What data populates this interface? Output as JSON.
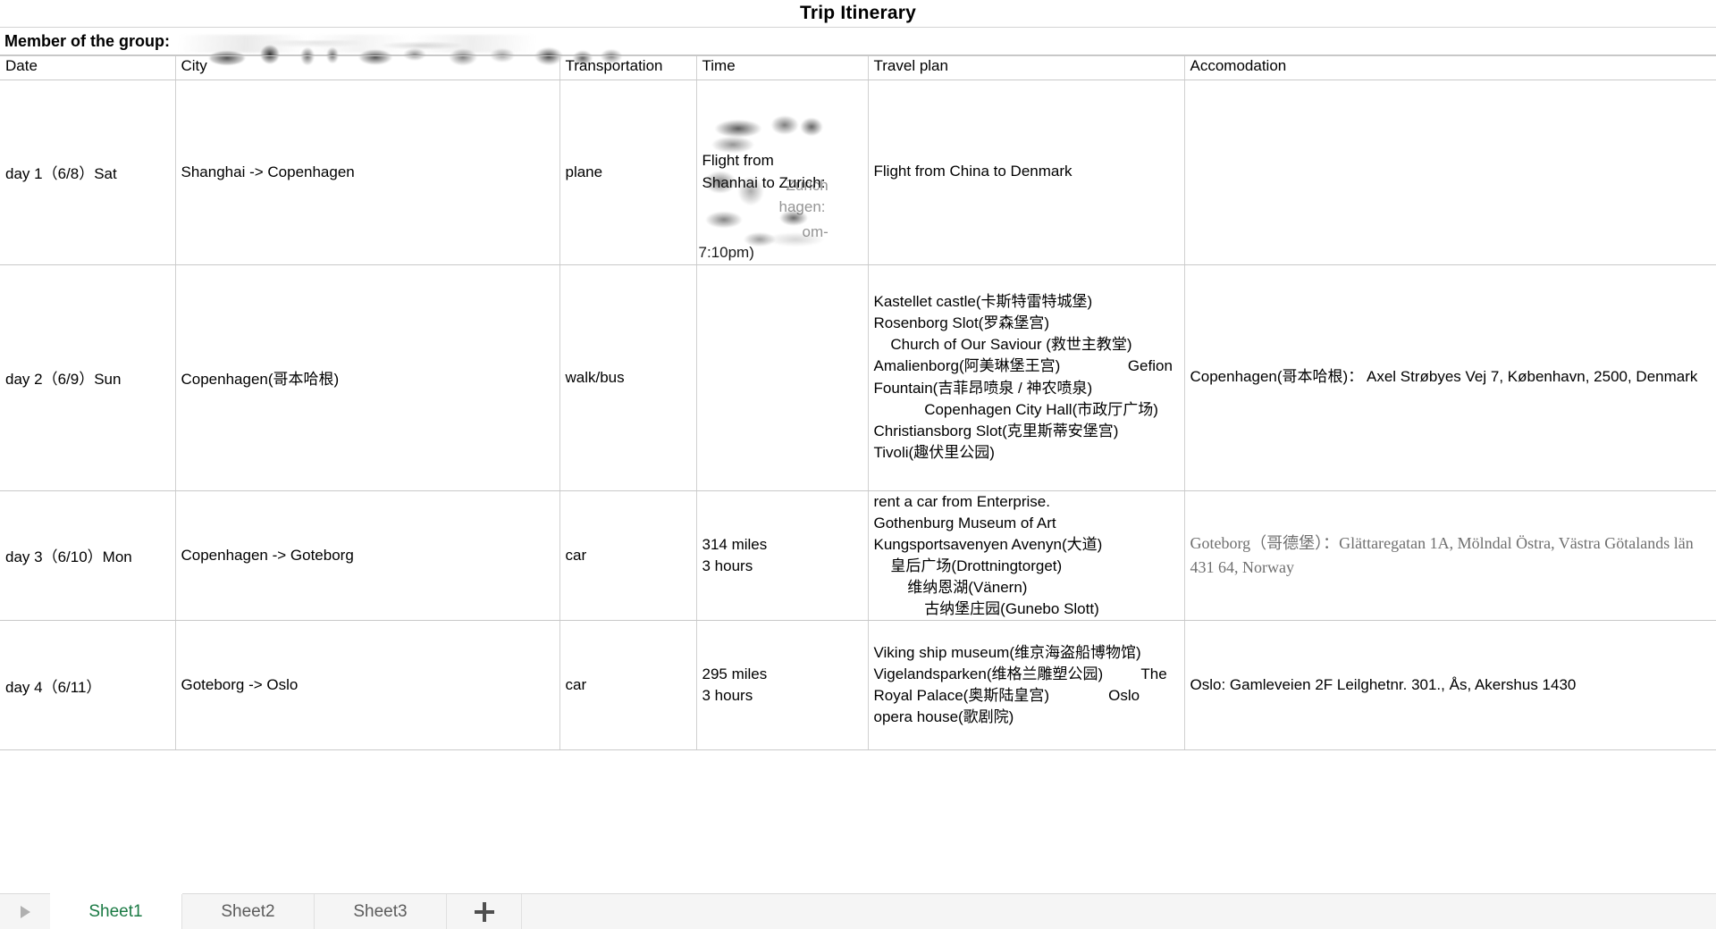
{
  "document": {
    "title": "Trip Itinerary",
    "member_label": "Member of the group:",
    "member_value_redacted": ""
  },
  "table": {
    "headers": {
      "date": "Date",
      "city": "City",
      "transportation": "Transportation",
      "time": "Time",
      "travel_plan": "Travel plan",
      "accomodation": "Accomodation"
    },
    "rows": [
      {
        "date": "day 1（6/8）Sat",
        "city": "Shanghai -> Copenhagen",
        "transportation": "plane",
        "time": "Flight from\nShanhai to Zurich:",
        "time_ghost_zurich": "Zurich",
        "time_ghost_hagen": "hagen:",
        "time_ghost_pm": "om-",
        "time_tail": "7:10pm)",
        "travel_plan": "Flight from China to Denmark",
        "accomodation": ""
      },
      {
        "date": "day 2（6/9）Sun",
        "city": "Copenhagen(哥本哈根)",
        "transportation": "walk/bus",
        "time": "",
        "travel_plan": "Kastellet castle(卡斯特雷特城堡)\nRosenborg Slot(罗森堡宫)\n    Church of Our Saviour (救世主教堂)                Amalienborg(阿美琳堡王宫)                Gefion Fountain(吉菲昂喷泉 / 神农喷泉)\n            Copenhagen City Hall(市政厅广场)\nChristiansborg Slot(克里斯蒂安堡宫)            Tivoli(趣伏里公园)",
        "accomodation": "Copenhagen(哥本哈根)： Axel Strøbyes Vej 7, København, 2500, Denmark"
      },
      {
        "date": "day 3（6/10）Mon",
        "city": "Copenhagen -> Goteborg",
        "transportation": "car",
        "time": "314 miles\n3 hours",
        "travel_plan": "rent a car from Enterprise.\nGothenburg Museum of Art\nKungsportsavenyen Avenyn(大道)\n    皇后广场(Drottningtorget)\n        维纳恩湖(Vänern)\n            古纳堡庄园(Gunebo Slott)",
        "accomodation": "Goteborg（哥德堡）：Glättaregatan 1A, Mölndal Östra, Västra Götalands län 431 64, Norway"
      },
      {
        "date": "day 4（6/11）",
        "city": "Goteborg -> Oslo",
        "transportation": "car",
        "time": "295 miles\n3 hours",
        "travel_plan": "Viking ship museum(维京海盗船博物馆)   Vigelandsparken(维格兰雕塑公园)         The Royal Palace(奥斯陆皇宫)              Oslo opera house(歌剧院)",
        "accomodation": "Oslo: Gamleveien 2F Leilghetnr. 301., Ås, Akershus 1430"
      }
    ]
  },
  "tabbar": {
    "nav_next_icon": "triangle-right-icon",
    "add_icon": "plus-icon",
    "tabs": [
      {
        "label": "Sheet1",
        "active": true
      },
      {
        "label": "Sheet2",
        "active": false
      },
      {
        "label": "Sheet3",
        "active": false
      }
    ]
  },
  "colors": {
    "active_tab_text": "#1a7a44",
    "grid_line": "#c9c9c9",
    "muted_text": "#6f6f6f"
  }
}
